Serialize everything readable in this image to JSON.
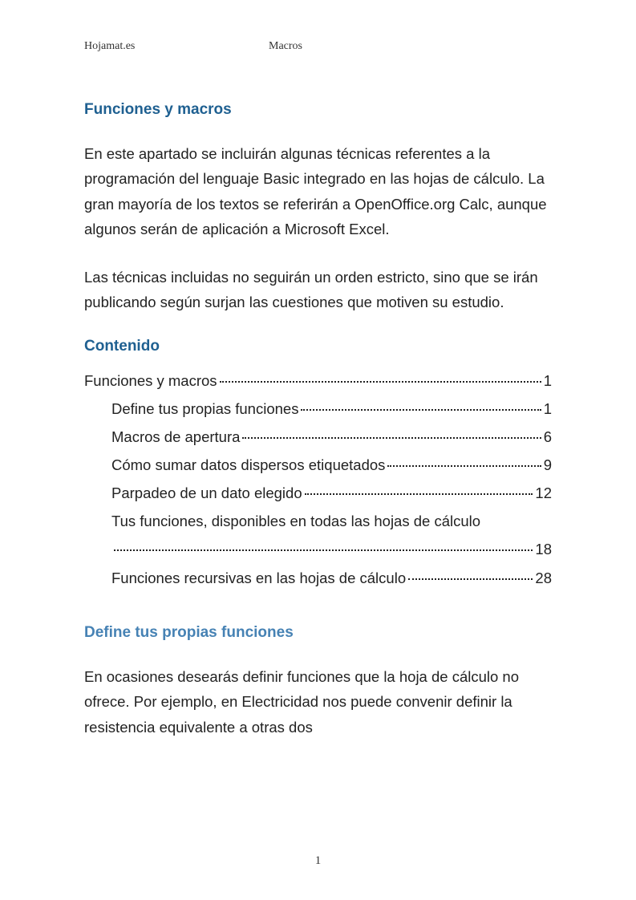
{
  "header": {
    "left": "Hojamat.es",
    "center": "Macros"
  },
  "title": "Funciones y macros",
  "intro_p1": "En este apartado se incluirán algunas técnicas referentes a la programación del lenguaje Basic integrado en las hojas de cálculo. La gran mayoría de los textos se referirán a OpenOffice.org Calc, aunque algunos serán de aplicación a Microsoft Excel.",
  "intro_p2": "Las técnicas incluidas no seguirán un orden estricto, sino que se irán publicando según surjan las cuestiones que motiven su estudio.",
  "toc_heading": "Contenido",
  "toc": [
    {
      "title": "Funciones y macros",
      "page": "1",
      "indent": false
    },
    {
      "title": "Define tus propias funciones",
      "page": "1",
      "indent": true
    },
    {
      "title": "Macros de apertura",
      "page": "6",
      "indent": true
    },
    {
      "title": "Cómo sumar datos dispersos etiquetados",
      "page": "9",
      "indent": true
    },
    {
      "title": "Parpadeo de un dato elegido",
      "page": "12",
      "indent": true
    },
    {
      "title": "Tus funciones, disponibles en todas las hojas de cálculo",
      "page": "18",
      "indent": true,
      "wrap": true
    },
    {
      "title": "Funciones recursivas en las hojas de cálculo",
      "page": "28",
      "indent": true
    }
  ],
  "section_heading": "Define tus propias funciones",
  "section_p1": "En ocasiones desearás definir funciones que la hoja de cálculo no ofrece. Por ejemplo, en Electricidad nos puede convenir definir la resistencia equivalente a otras dos",
  "page_number": "1"
}
